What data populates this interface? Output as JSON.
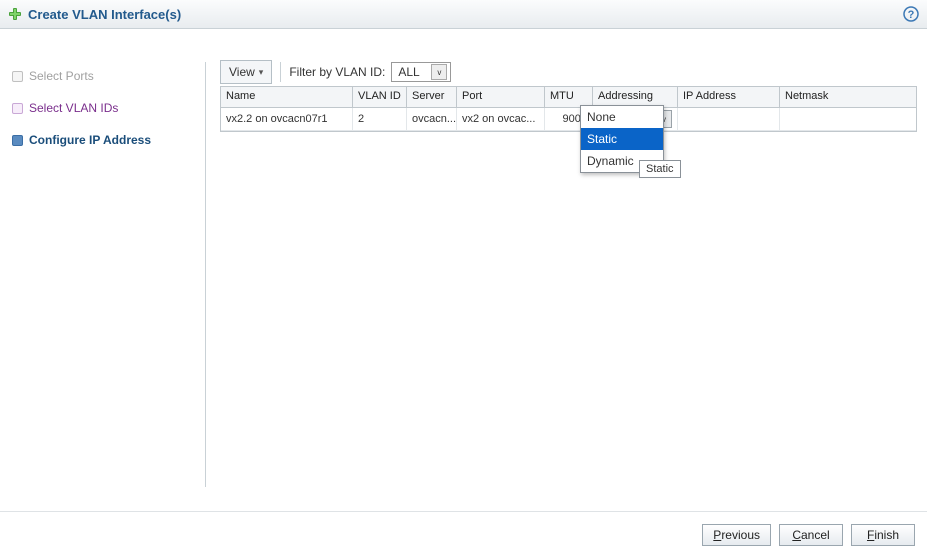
{
  "header": {
    "title": "Create VLAN Interface(s)"
  },
  "steps": [
    {
      "label": "Select Ports",
      "state": "done"
    },
    {
      "label": "Select VLAN IDs",
      "state": "visited"
    },
    {
      "label": "Configure IP Address",
      "state": "current"
    }
  ],
  "toolbar": {
    "view_label": "View",
    "filter_label": "Filter by VLAN ID:",
    "filter_value": "ALL"
  },
  "table": {
    "columns": [
      "Name",
      "VLAN ID",
      "Server",
      "Port",
      "MTU",
      "Addressing",
      "IP Address",
      "Netmask"
    ],
    "rows": [
      {
        "name": "vx2.2 on ovcacn07r1",
        "vlan_id": "2",
        "server": "ovcacn...",
        "port": "vx2 on ovcac...",
        "mtu": "9000",
        "addressing": "None",
        "ip": "",
        "netmask": ""
      }
    ]
  },
  "addressing_dropdown": {
    "options": [
      "None",
      "Static",
      "Dynamic"
    ],
    "highlighted": "Static",
    "tooltip": "Static"
  },
  "footer": {
    "previous": "Previous",
    "cancel": "Cancel",
    "finish": "Finish"
  },
  "icons": {
    "plus": "plus-icon",
    "help": "help-icon",
    "chevron_down": "chevron-down-icon"
  },
  "colors": {
    "accent": "#225a8d",
    "selection": "#0a64c8",
    "visited": "#7a2e8c"
  }
}
